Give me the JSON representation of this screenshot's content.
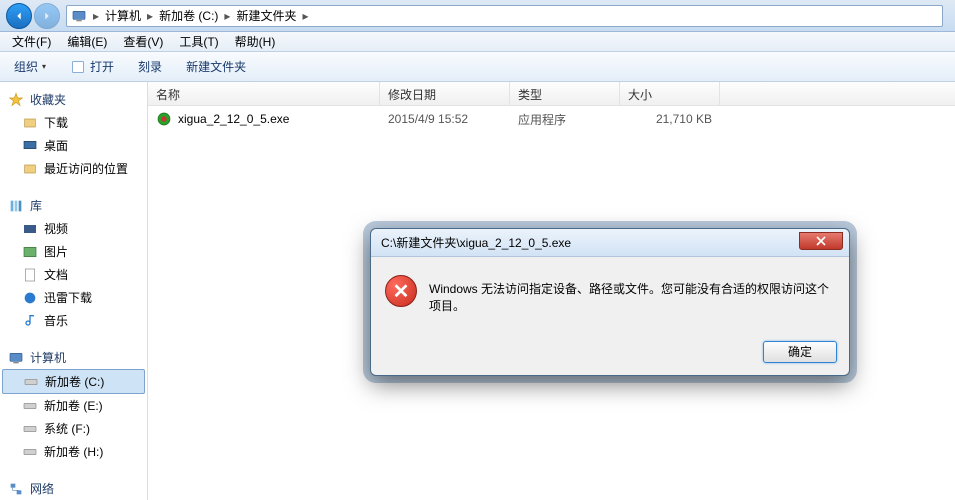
{
  "breadcrumb": {
    "parts": [
      "计算机",
      "新加卷 (C:)",
      "新建文件夹"
    ]
  },
  "menus": {
    "file": "文件(F)",
    "edit": "编辑(E)",
    "view": "查看(V)",
    "tools": "工具(T)",
    "help": "帮助(H)"
  },
  "toolbar": {
    "organize": "组织",
    "open": "打开",
    "burn": "刻录",
    "newfolder": "新建文件夹"
  },
  "sidebar": {
    "favorites": {
      "label": "收藏夹",
      "items": [
        "下载",
        "桌面",
        "最近访问的位置"
      ]
    },
    "libraries": {
      "label": "库",
      "items": [
        "视频",
        "图片",
        "文档",
        "迅雷下载",
        "音乐"
      ]
    },
    "computer": {
      "label": "计算机",
      "items": [
        "新加卷 (C:)",
        "新加卷 (E:)",
        "系统 (F:)",
        "新加卷 (H:)"
      ]
    },
    "network": {
      "label": "网络"
    }
  },
  "columns": {
    "name": "名称",
    "date": "修改日期",
    "type": "类型",
    "size": "大小"
  },
  "files": [
    {
      "name": "xigua_2_12_0_5.exe",
      "date": "2015/4/9 15:52",
      "type": "应用程序",
      "size": "21,710 KB"
    }
  ],
  "dialog": {
    "title": "C:\\新建文件夹\\xigua_2_12_0_5.exe",
    "message": "Windows 无法访问指定设备、路径或文件。您可能没有合适的权限访问这个项目。",
    "ok": "确定"
  }
}
